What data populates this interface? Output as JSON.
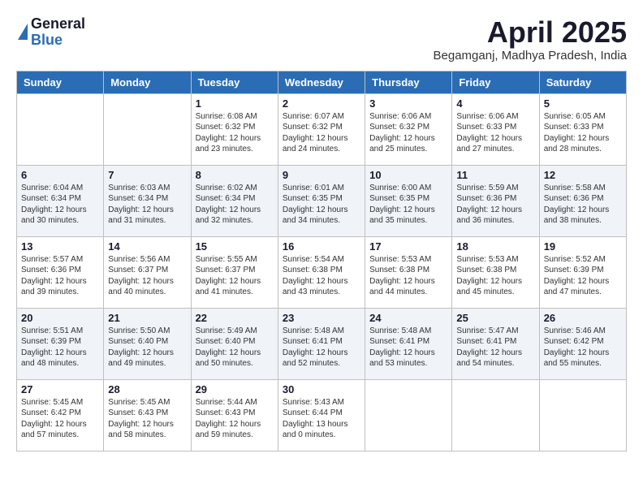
{
  "header": {
    "logo_general": "General",
    "logo_blue": "Blue",
    "month_title": "April 2025",
    "location": "Begamganj, Madhya Pradesh, India"
  },
  "days_of_week": [
    "Sunday",
    "Monday",
    "Tuesday",
    "Wednesday",
    "Thursday",
    "Friday",
    "Saturday"
  ],
  "weeks": [
    [
      {
        "day": "",
        "sunrise": "",
        "sunset": "",
        "daylight": ""
      },
      {
        "day": "",
        "sunrise": "",
        "sunset": "",
        "daylight": ""
      },
      {
        "day": "1",
        "sunrise": "Sunrise: 6:08 AM",
        "sunset": "Sunset: 6:32 PM",
        "daylight": "Daylight: 12 hours and 23 minutes."
      },
      {
        "day": "2",
        "sunrise": "Sunrise: 6:07 AM",
        "sunset": "Sunset: 6:32 PM",
        "daylight": "Daylight: 12 hours and 24 minutes."
      },
      {
        "day": "3",
        "sunrise": "Sunrise: 6:06 AM",
        "sunset": "Sunset: 6:32 PM",
        "daylight": "Daylight: 12 hours and 25 minutes."
      },
      {
        "day": "4",
        "sunrise": "Sunrise: 6:06 AM",
        "sunset": "Sunset: 6:33 PM",
        "daylight": "Daylight: 12 hours and 27 minutes."
      },
      {
        "day": "5",
        "sunrise": "Sunrise: 6:05 AM",
        "sunset": "Sunset: 6:33 PM",
        "daylight": "Daylight: 12 hours and 28 minutes."
      }
    ],
    [
      {
        "day": "6",
        "sunrise": "Sunrise: 6:04 AM",
        "sunset": "Sunset: 6:34 PM",
        "daylight": "Daylight: 12 hours and 30 minutes."
      },
      {
        "day": "7",
        "sunrise": "Sunrise: 6:03 AM",
        "sunset": "Sunset: 6:34 PM",
        "daylight": "Daylight: 12 hours and 31 minutes."
      },
      {
        "day": "8",
        "sunrise": "Sunrise: 6:02 AM",
        "sunset": "Sunset: 6:34 PM",
        "daylight": "Daylight: 12 hours and 32 minutes."
      },
      {
        "day": "9",
        "sunrise": "Sunrise: 6:01 AM",
        "sunset": "Sunset: 6:35 PM",
        "daylight": "Daylight: 12 hours and 34 minutes."
      },
      {
        "day": "10",
        "sunrise": "Sunrise: 6:00 AM",
        "sunset": "Sunset: 6:35 PM",
        "daylight": "Daylight: 12 hours and 35 minutes."
      },
      {
        "day": "11",
        "sunrise": "Sunrise: 5:59 AM",
        "sunset": "Sunset: 6:36 PM",
        "daylight": "Daylight: 12 hours and 36 minutes."
      },
      {
        "day": "12",
        "sunrise": "Sunrise: 5:58 AM",
        "sunset": "Sunset: 6:36 PM",
        "daylight": "Daylight: 12 hours and 38 minutes."
      }
    ],
    [
      {
        "day": "13",
        "sunrise": "Sunrise: 5:57 AM",
        "sunset": "Sunset: 6:36 PM",
        "daylight": "Daylight: 12 hours and 39 minutes."
      },
      {
        "day": "14",
        "sunrise": "Sunrise: 5:56 AM",
        "sunset": "Sunset: 6:37 PM",
        "daylight": "Daylight: 12 hours and 40 minutes."
      },
      {
        "day": "15",
        "sunrise": "Sunrise: 5:55 AM",
        "sunset": "Sunset: 6:37 PM",
        "daylight": "Daylight: 12 hours and 41 minutes."
      },
      {
        "day": "16",
        "sunrise": "Sunrise: 5:54 AM",
        "sunset": "Sunset: 6:38 PM",
        "daylight": "Daylight: 12 hours and 43 minutes."
      },
      {
        "day": "17",
        "sunrise": "Sunrise: 5:53 AM",
        "sunset": "Sunset: 6:38 PM",
        "daylight": "Daylight: 12 hours and 44 minutes."
      },
      {
        "day": "18",
        "sunrise": "Sunrise: 5:53 AM",
        "sunset": "Sunset: 6:38 PM",
        "daylight": "Daylight: 12 hours and 45 minutes."
      },
      {
        "day": "19",
        "sunrise": "Sunrise: 5:52 AM",
        "sunset": "Sunset: 6:39 PM",
        "daylight": "Daylight: 12 hours and 47 minutes."
      }
    ],
    [
      {
        "day": "20",
        "sunrise": "Sunrise: 5:51 AM",
        "sunset": "Sunset: 6:39 PM",
        "daylight": "Daylight: 12 hours and 48 minutes."
      },
      {
        "day": "21",
        "sunrise": "Sunrise: 5:50 AM",
        "sunset": "Sunset: 6:40 PM",
        "daylight": "Daylight: 12 hours and 49 minutes."
      },
      {
        "day": "22",
        "sunrise": "Sunrise: 5:49 AM",
        "sunset": "Sunset: 6:40 PM",
        "daylight": "Daylight: 12 hours and 50 minutes."
      },
      {
        "day": "23",
        "sunrise": "Sunrise: 5:48 AM",
        "sunset": "Sunset: 6:41 PM",
        "daylight": "Daylight: 12 hours and 52 minutes."
      },
      {
        "day": "24",
        "sunrise": "Sunrise: 5:48 AM",
        "sunset": "Sunset: 6:41 PM",
        "daylight": "Daylight: 12 hours and 53 minutes."
      },
      {
        "day": "25",
        "sunrise": "Sunrise: 5:47 AM",
        "sunset": "Sunset: 6:41 PM",
        "daylight": "Daylight: 12 hours and 54 minutes."
      },
      {
        "day": "26",
        "sunrise": "Sunrise: 5:46 AM",
        "sunset": "Sunset: 6:42 PM",
        "daylight": "Daylight: 12 hours and 55 minutes."
      }
    ],
    [
      {
        "day": "27",
        "sunrise": "Sunrise: 5:45 AM",
        "sunset": "Sunset: 6:42 PM",
        "daylight": "Daylight: 12 hours and 57 minutes."
      },
      {
        "day": "28",
        "sunrise": "Sunrise: 5:45 AM",
        "sunset": "Sunset: 6:43 PM",
        "daylight": "Daylight: 12 hours and 58 minutes."
      },
      {
        "day": "29",
        "sunrise": "Sunrise: 5:44 AM",
        "sunset": "Sunset: 6:43 PM",
        "daylight": "Daylight: 12 hours and 59 minutes."
      },
      {
        "day": "30",
        "sunrise": "Sunrise: 5:43 AM",
        "sunset": "Sunset: 6:44 PM",
        "daylight": "Daylight: 13 hours and 0 minutes."
      },
      {
        "day": "",
        "sunrise": "",
        "sunset": "",
        "daylight": ""
      },
      {
        "day": "",
        "sunrise": "",
        "sunset": "",
        "daylight": ""
      },
      {
        "day": "",
        "sunrise": "",
        "sunset": "",
        "daylight": ""
      }
    ]
  ]
}
